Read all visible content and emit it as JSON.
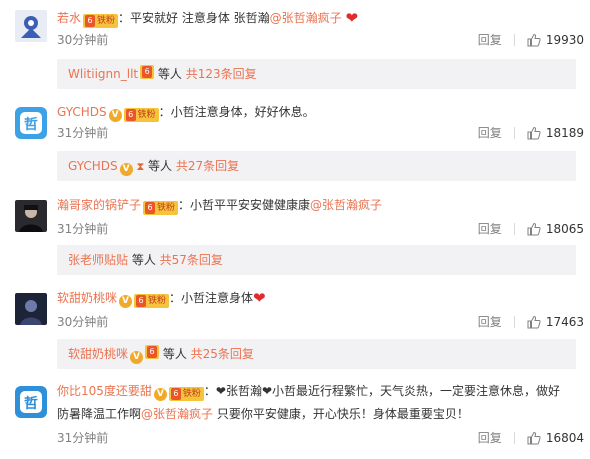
{
  "colors": {
    "link": "#eb7350",
    "muted": "#808080",
    "subbar": "#f2f2f5",
    "heart": "#e02c2c"
  },
  "comments": [
    {
      "user": "若水",
      "verified": false,
      "fan_badge": "铁粉",
      "text_pre": "：平安就好 注意身体 张哲瀚",
      "mention": "@张哲瀚疯子",
      "text_post": "",
      "has_heart": true,
      "time": "30分钟前",
      "reply": "回复",
      "likes": "19930",
      "sub": {
        "user": "Wlitiignn_llt",
        "icon": "fan-badge-icon",
        "mid": " 等人 ",
        "more": "共123条回复"
      }
    },
    {
      "user": "GYCHDS",
      "verified": true,
      "fan_badge": "铁粉",
      "text_pre": "：小哲注意身体，好好休息。",
      "mention": "",
      "text_post": "",
      "has_heart": false,
      "time": "31分钟前",
      "reply": "回复",
      "likes": "18189",
      "sub": {
        "user": "GYCHDS",
        "icon": "hourglass-icon",
        "mid": " 等人 ",
        "more": "共27条回复"
      }
    },
    {
      "user": "瀚哥家的锅铲子",
      "verified": false,
      "fan_badge": "铁粉",
      "text_pre": "：小哲平平安安健健康康",
      "mention": "@张哲瀚疯子",
      "text_post": "",
      "has_heart": false,
      "time": "31分钟前",
      "reply": "回复",
      "likes": "18065",
      "sub": {
        "user": "张老师贴贴",
        "icon": "",
        "mid": " 等人 ",
        "more": "共57条回复"
      }
    },
    {
      "user": "软甜奶桃咪",
      "verified": true,
      "fan_badge": "铁粉",
      "text_pre": "：小哲注意身体",
      "mention": "",
      "text_post": "",
      "has_heart": true,
      "time": "30分钟前",
      "reply": "回复",
      "likes": "17463",
      "sub": {
        "user": "软甜奶桃咪",
        "icon": "fan-badge-icon",
        "mid": " 等人 ",
        "more": "共25条回复"
      }
    },
    {
      "user": "你比105度还要甜",
      "verified": true,
      "fan_badge": "铁粉",
      "text_pre": "：❤张哲瀚❤小哲最近行程繁忙，天气炎热，一定要注意休息，做好",
      "text_line2_pre": "防暑降温工作啊",
      "mention": "@张哲瀚疯子",
      "text_post": " 只要你平安健康，开心快乐！身体最重要宝贝！",
      "has_heart": false,
      "time": "31分钟前",
      "reply": "回复",
      "likes": "16804"
    }
  ]
}
